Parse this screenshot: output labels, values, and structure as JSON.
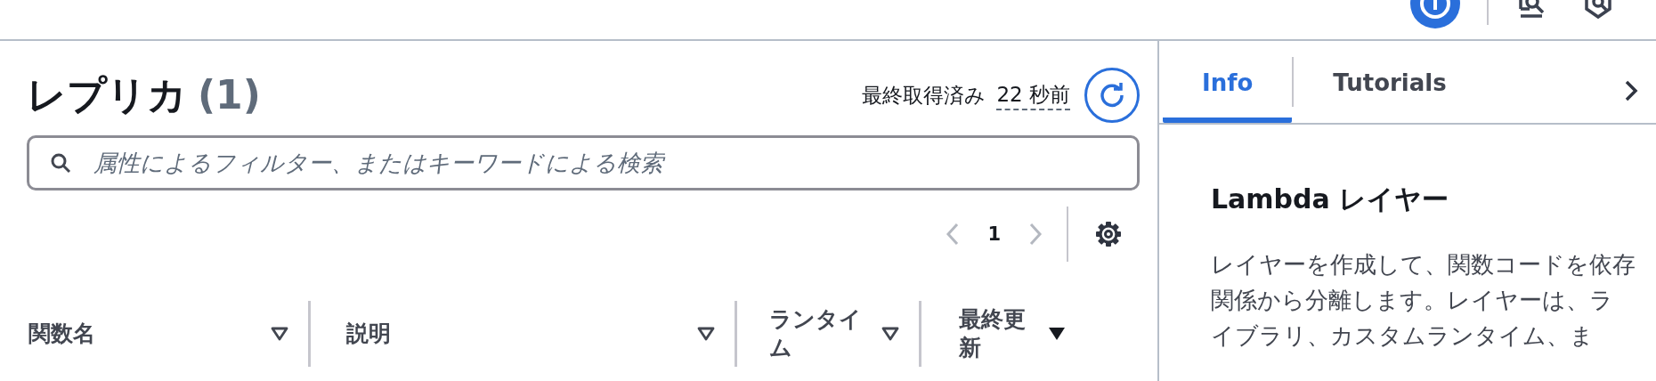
{
  "header": {
    "title": "レプリカ",
    "count": "(1)",
    "last_fetched_label": "最終取得済み",
    "last_fetched_value": "22 秒前"
  },
  "search": {
    "placeholder": "属性によるフィルター、またはキーワードによる検索"
  },
  "pagination": {
    "page": "1"
  },
  "table": {
    "columns": [
      {
        "label": "関数名",
        "sorted": false
      },
      {
        "label": "説明",
        "sorted": false
      },
      {
        "label": "ランタイム",
        "sorted": false
      },
      {
        "label": "最終更新",
        "sorted": true
      }
    ]
  },
  "help_panel": {
    "tabs": [
      {
        "label": "Info",
        "selected": true
      },
      {
        "label": "Tutorials",
        "selected": false
      }
    ],
    "heading": "Lambda レイヤー",
    "body": "レイヤーを作成して、関数コードを依存関係から分離します。レイヤーは、ライブラリ、カスタムランタイム、ま"
  }
}
